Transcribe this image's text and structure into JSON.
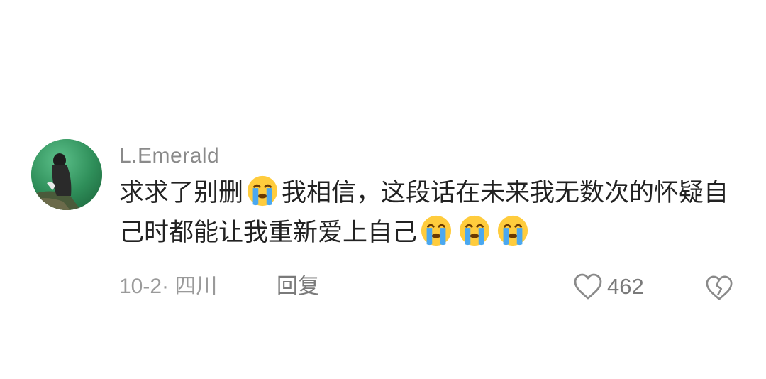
{
  "comment": {
    "username": "L.Emerald",
    "text_part1": "求求了别删",
    "text_part2": "我相信，这段话在未来我无数次的怀疑自己时都能让我重新爱上自己",
    "emoji_icon": "loudly-crying-face-icon",
    "date_location": "10-2· 四川",
    "reply_label": "回复",
    "like_count": "462",
    "like_icon": "heart-outline-icon",
    "dislike_icon": "broken-heart-icon"
  }
}
